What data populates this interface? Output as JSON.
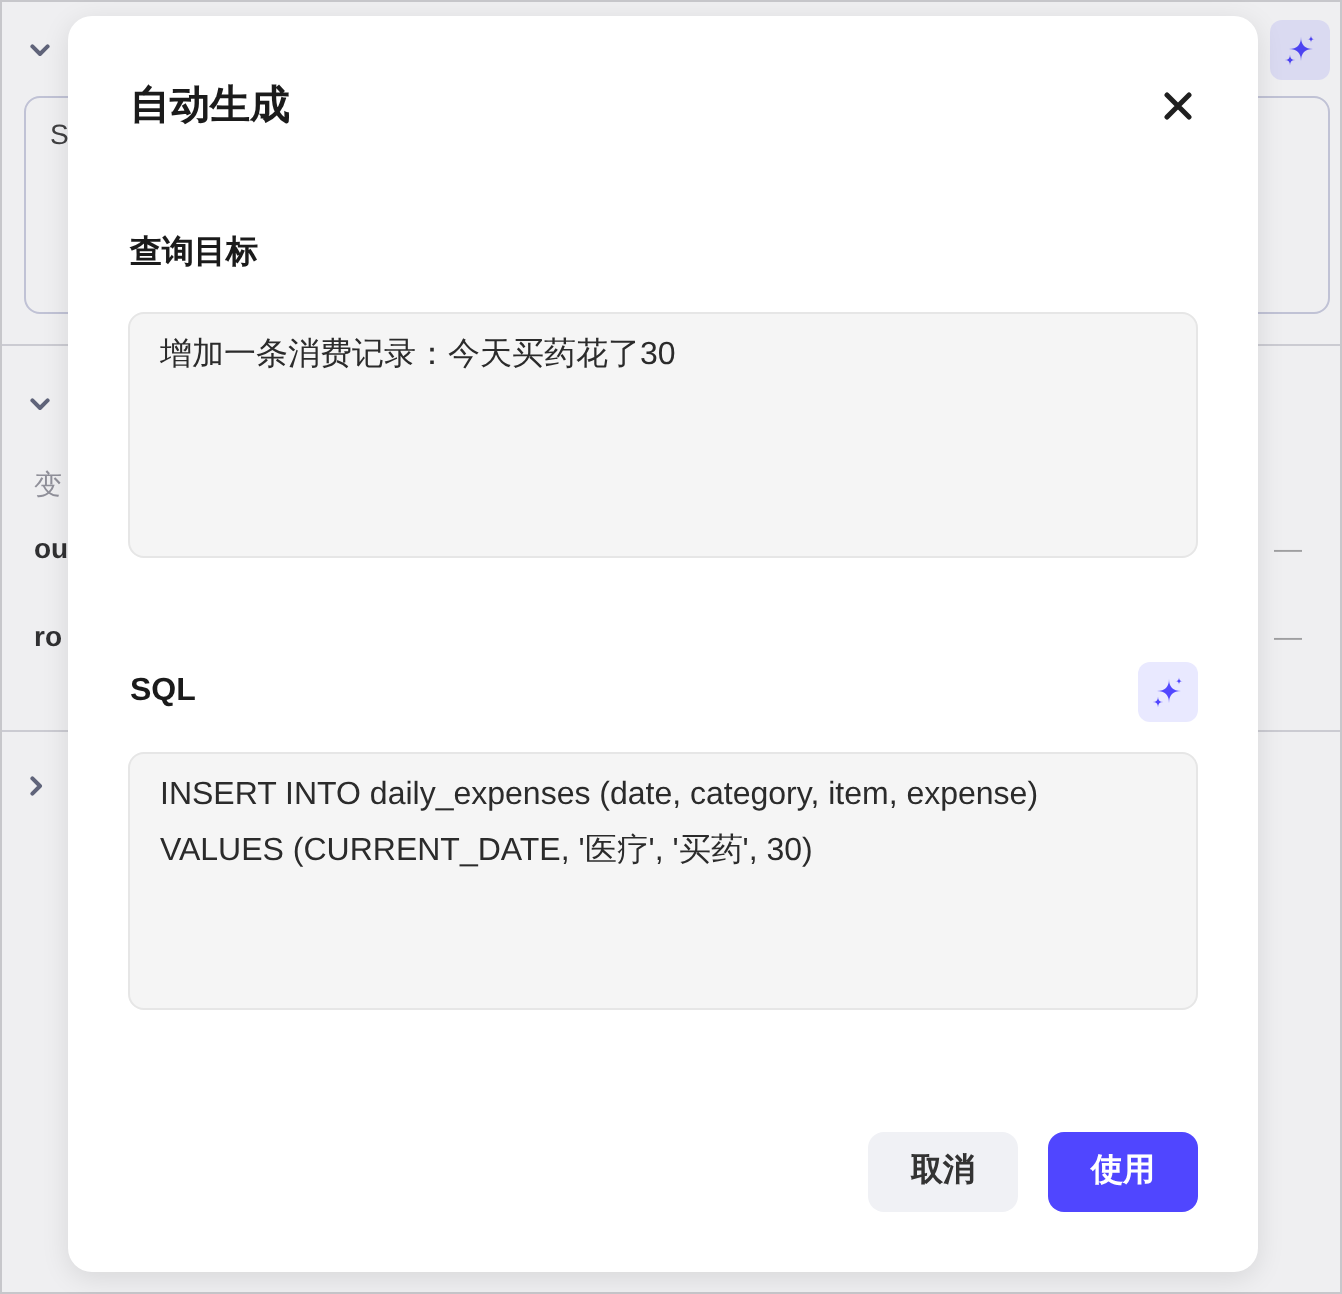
{
  "background": {
    "sections": [
      {
        "expanded": true,
        "generate_button": true,
        "field": {
          "value": "S"
        }
      },
      {
        "expanded": true,
        "label": "变",
        "rows": [
          {
            "name": "ou",
            "value": "—"
          },
          {
            "name": "ro",
            "value": "—"
          }
        ]
      },
      {
        "expanded": false
      }
    ]
  },
  "dialog": {
    "title": "自动生成",
    "fields": [
      {
        "label": "查询目标",
        "value": "增加一条消费记录：今天买药花了30",
        "generate_button": false
      },
      {
        "label": "SQL",
        "value": "INSERT INTO daily_expenses (date, category, item, expense)\nVALUES (CURRENT_DATE, '医疗', '买药', 30)",
        "generate_button": true
      }
    ],
    "buttons": [
      {
        "label": "取消",
        "kind": "secondary"
      },
      {
        "label": "使用",
        "kind": "primary"
      }
    ]
  }
}
